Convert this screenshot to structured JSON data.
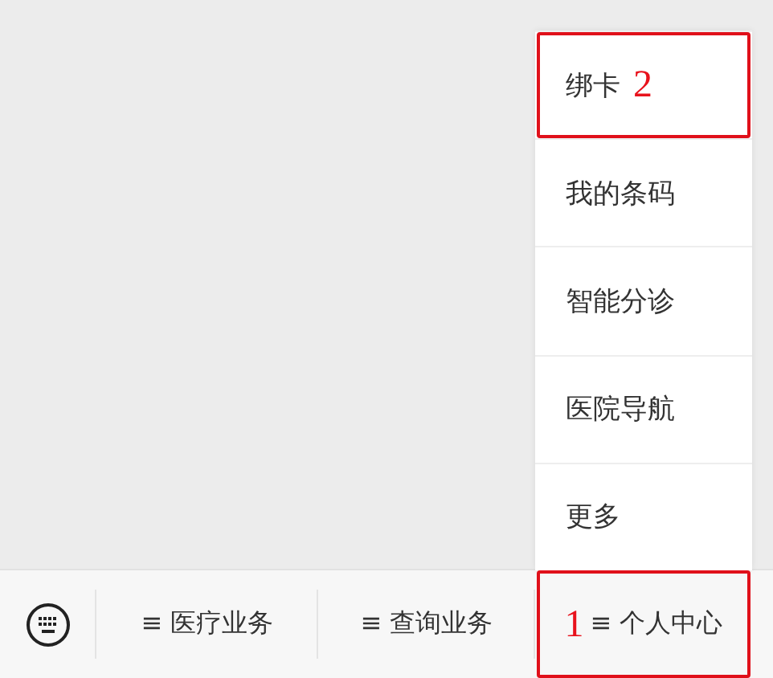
{
  "menu_bar": {
    "items": [
      {
        "label": "≡ 医疗业务"
      },
      {
        "label": "≡ 查询业务"
      },
      {
        "label": "≡ 个人中心",
        "submenu": [
          "绑卡",
          "我的条码",
          "智能分诊",
          "医院导航",
          "更多"
        ]
      }
    ]
  },
  "annotations": [
    {
      "kind": "tab",
      "number": "1"
    },
    {
      "kind": "entry",
      "number": "2"
    }
  ]
}
